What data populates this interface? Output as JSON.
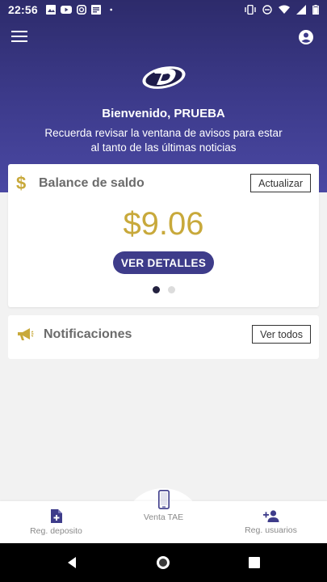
{
  "status_bar": {
    "time": "22:56",
    "left_icons": [
      "image-icon",
      "youtube-icon",
      "instagram-icon",
      "document-icon",
      "dot-icon"
    ],
    "right_icons": [
      "vibrate-icon",
      "dnd-icon",
      "wifi-icon",
      "signal-icon",
      "battery-icon"
    ]
  },
  "header": {
    "welcome": "Bienvenido, PRUEBA",
    "subtitle": "Recuerda revisar la ventana de avisos para estar al tanto de las últimas noticias"
  },
  "balance_card": {
    "title": "Balance de saldo",
    "refresh_label": "Actualizar",
    "amount": "$9.06",
    "details_label": "VER DETALLES",
    "carousel_pages": 2,
    "carousel_active": 1
  },
  "notifications_card": {
    "title": "Notificaciones",
    "view_all_label": "Ver todos"
  },
  "bottom_nav": {
    "items": [
      {
        "label": "Reg. deposito",
        "icon": "add-document-icon"
      },
      {
        "label": "Venta TAE",
        "icon": "phone-icon"
      },
      {
        "label": "Reg. usuarios",
        "icon": "add-user-icon"
      }
    ]
  },
  "colors": {
    "header_top": "#2d2b6b",
    "header_bottom": "#4a48a3",
    "gold": "#c8a93b",
    "primary": "#3e3c8a"
  }
}
